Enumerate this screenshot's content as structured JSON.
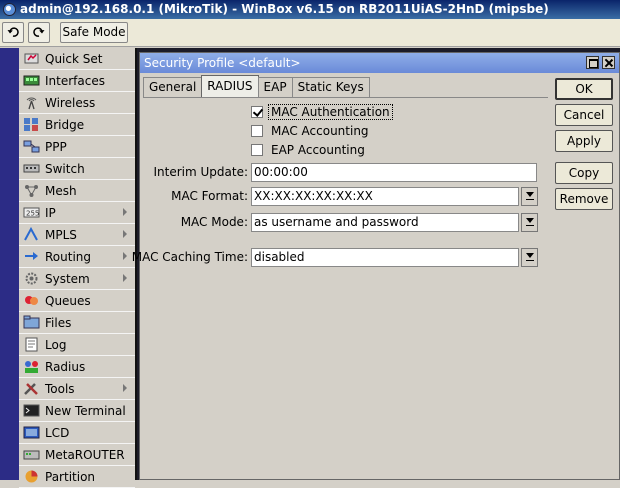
{
  "window": {
    "title": "admin@192.168.0.1 (MikroTik) - WinBox v6.15 on RB2011UiAS-2HnD (mipsbe)"
  },
  "toolbar": {
    "safe_mode_label": "Safe Mode"
  },
  "sidebar": {
    "items": [
      {
        "label": "Quick Set",
        "icon": "quick-set-icon",
        "submenu": false
      },
      {
        "label": "Interfaces",
        "icon": "interfaces-icon",
        "submenu": false
      },
      {
        "label": "Wireless",
        "icon": "wireless-icon",
        "submenu": false
      },
      {
        "label": "Bridge",
        "icon": "bridge-icon",
        "submenu": false
      },
      {
        "label": "PPP",
        "icon": "ppp-icon",
        "submenu": false
      },
      {
        "label": "Switch",
        "icon": "switch-icon",
        "submenu": false
      },
      {
        "label": "Mesh",
        "icon": "mesh-icon",
        "submenu": false
      },
      {
        "label": "IP",
        "icon": "ip-icon",
        "submenu": true
      },
      {
        "label": "MPLS",
        "icon": "mpls-icon",
        "submenu": true
      },
      {
        "label": "Routing",
        "icon": "routing-icon",
        "submenu": true
      },
      {
        "label": "System",
        "icon": "system-gear-icon",
        "submenu": true
      },
      {
        "label": "Queues",
        "icon": "queues-icon",
        "submenu": false
      },
      {
        "label": "Files",
        "icon": "files-icon",
        "submenu": false
      },
      {
        "label": "Log",
        "icon": "log-icon",
        "submenu": false
      },
      {
        "label": "Radius",
        "icon": "radius-icon",
        "submenu": false
      },
      {
        "label": "Tools",
        "icon": "tools-icon",
        "submenu": true
      },
      {
        "label": "New Terminal",
        "icon": "terminal-icon",
        "submenu": false
      },
      {
        "label": "LCD",
        "icon": "lcd-icon",
        "submenu": false
      },
      {
        "label": "MetaROUTER",
        "icon": "metarouter-icon",
        "submenu": false
      },
      {
        "label": "Partition",
        "icon": "partition-icon",
        "submenu": false
      }
    ]
  },
  "dialog": {
    "title": "Security Profile <default>",
    "tabs": [
      {
        "label": "General",
        "active": false
      },
      {
        "label": "RADIUS",
        "active": true
      },
      {
        "label": "EAP",
        "active": false
      },
      {
        "label": "Static Keys",
        "active": false
      }
    ],
    "checkboxes": [
      {
        "label": "MAC Authentication",
        "checked": true
      },
      {
        "label": "MAC Accounting",
        "checked": false
      },
      {
        "label": "EAP Accounting",
        "checked": false
      }
    ],
    "fields": {
      "interim_update": {
        "label": "Interim Update:",
        "value": "00:00:00"
      },
      "mac_format": {
        "label": "MAC Format:",
        "value": "XX:XX:XX:XX:XX:XX"
      },
      "mac_mode": {
        "label": "MAC Mode:",
        "value": "as username and password"
      },
      "mac_caching_time": {
        "label": "MAC Caching Time:",
        "value": "disabled"
      }
    },
    "buttons": {
      "ok": "OK",
      "cancel": "Cancel",
      "apply": "Apply",
      "copy": "Copy",
      "remove": "Remove"
    }
  }
}
